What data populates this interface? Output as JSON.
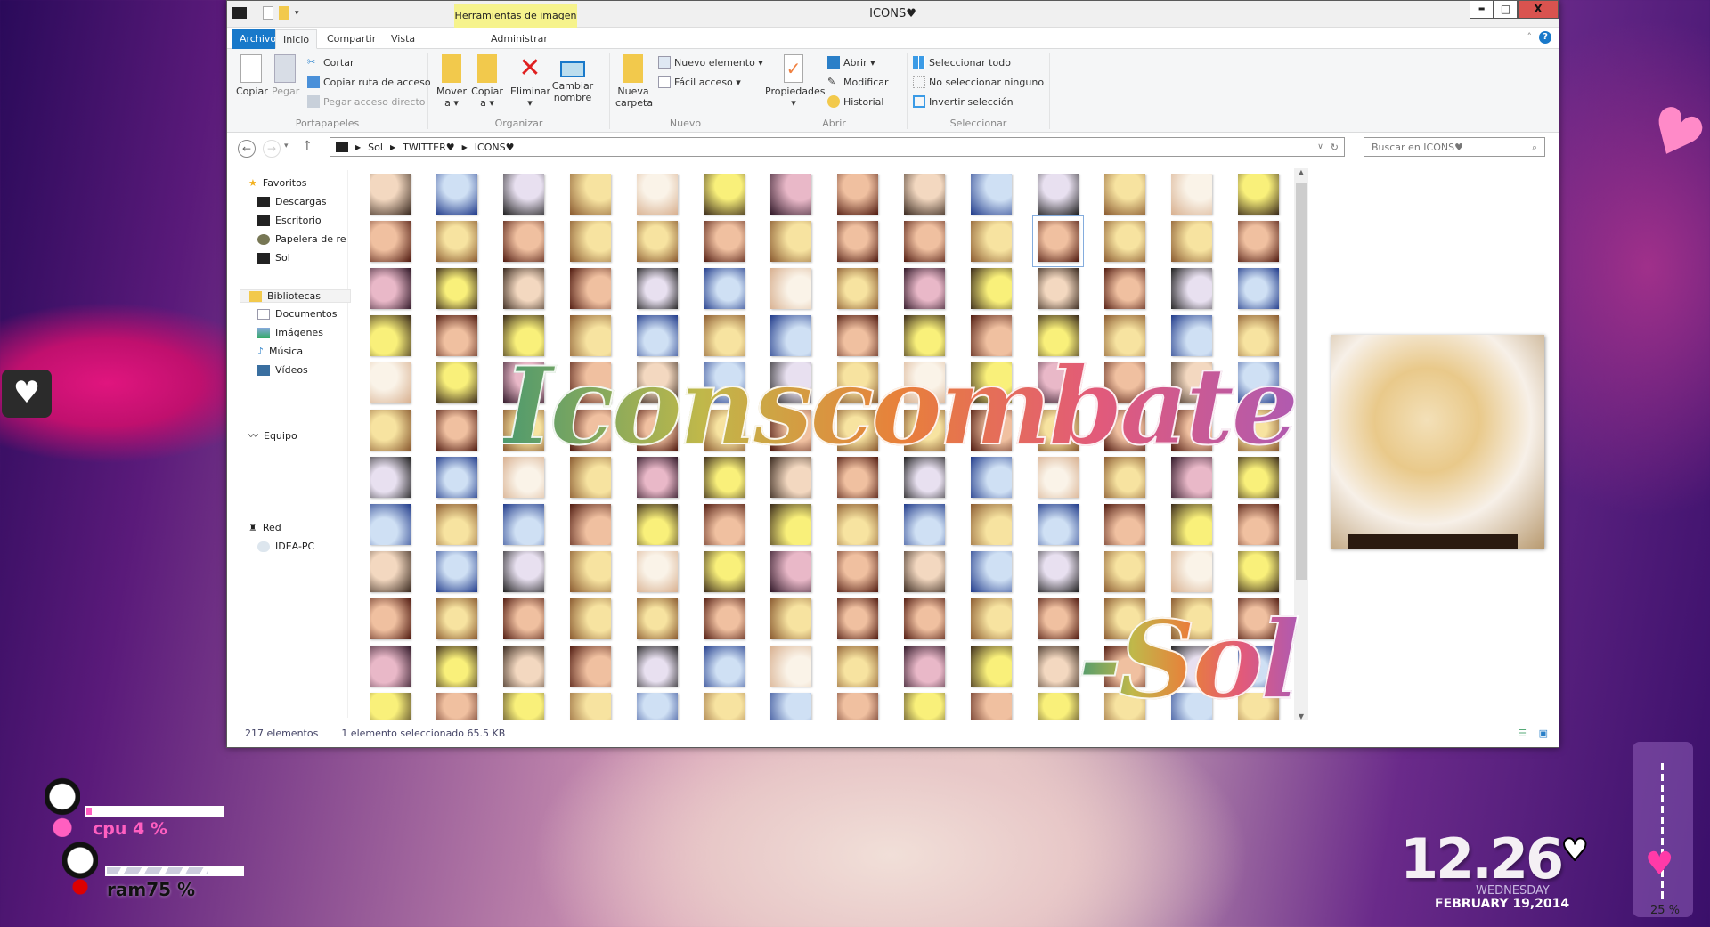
{
  "window": {
    "title": "ICONS♥",
    "context_tab": "Herramientas de imagen",
    "controls": {
      "minimize": "▬",
      "maximize": "□",
      "close": "X"
    }
  },
  "tabs": [
    "Archivo",
    "Inicio",
    "Compartir",
    "Vista",
    "Administrar"
  ],
  "ribbon": {
    "portapapeles": {
      "label": "Portapapeles",
      "copiar": "Copiar",
      "pegar": "Pegar",
      "cortar": "Cortar",
      "copiar_ruta": "Copiar ruta de acceso",
      "pegar_acceso": "Pegar acceso directo"
    },
    "organizar": {
      "label": "Organizar",
      "mover": "Mover a ▾",
      "copiar": "Copiar a ▾",
      "eliminar": "Eliminar ▾",
      "cambiar": "Cambiar nombre"
    },
    "nuevo": {
      "label": "Nuevo",
      "carpeta": "Nueva carpeta",
      "elemento": "Nuevo elemento ▾",
      "facil": "Fácil acceso ▾"
    },
    "abrir": {
      "label": "Abrir",
      "propiedades": "Propiedades ▾",
      "abrir": "Abrir ▾",
      "modificar": "Modificar",
      "historial": "Historial"
    },
    "seleccionar": {
      "label": "Seleccionar",
      "todo": "Seleccionar todo",
      "ninguno": "No seleccionar ninguno",
      "invertir": "Invertir selección"
    }
  },
  "address": {
    "crumbs": [
      "Sol",
      "TWITTER♥",
      "ICONS♥"
    ],
    "search_placeholder": "Buscar en ICONS♥"
  },
  "nav": {
    "favoritos": "Favoritos",
    "descargas": "Descargas",
    "escritorio": "Escritorio",
    "papelera": "Papelera de re",
    "sol": "Sol",
    "bibliotecas": "Bibliotecas",
    "documentos": "Documentos",
    "imagenes": "Imágenes",
    "musica": "Música",
    "videos": "Vídeos",
    "equipo": "Equipo",
    "red": "Red",
    "idea": "IDEA-PC"
  },
  "status": {
    "count": "217 elementos",
    "selected": "1 elemento seleccionado  65.5 KB"
  },
  "watermark": {
    "line1": "Iconscombate",
    "line2": "-Sol"
  },
  "desktop": {
    "cpu_label": "cpu 4 %",
    "cpu_percent": 4,
    "ram_label": "ram75 %",
    "ram_percent": 75,
    "time": "12.26",
    "day": "WEDNESDAY",
    "date": "FEBRUARY 19,2014",
    "volume_label": "25 %",
    "volume_percent": 25
  },
  "colors": {
    "accent": "#1979ca",
    "context": "#f6f38c",
    "close": "#d9534f",
    "cpu": "#ff5fc0"
  }
}
